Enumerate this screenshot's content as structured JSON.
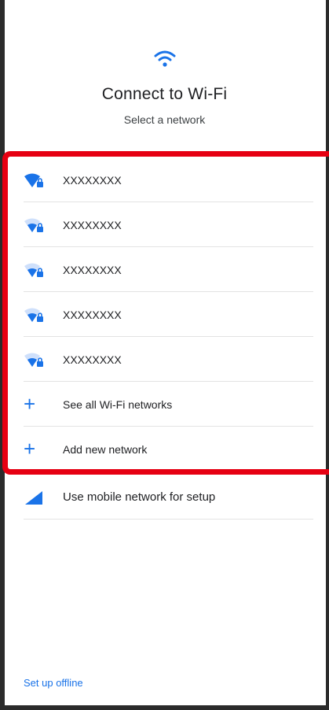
{
  "header": {
    "wifi_icon": "wifi-icon",
    "title": "Connect to Wi-Fi",
    "subtitle": "Select a network"
  },
  "networks": [
    {
      "name": "XXXXXXXX",
      "signal": "full",
      "icon": "wifi-lock-icon"
    },
    {
      "name": "XXXXXXXX",
      "signal": "partial",
      "icon": "wifi-lock-icon"
    },
    {
      "name": "XXXXXXXX",
      "signal": "partial",
      "icon": "wifi-lock-icon"
    },
    {
      "name": "XXXXXXXX",
      "signal": "partial",
      "icon": "wifi-lock-icon"
    },
    {
      "name": "XXXXXXXX",
      "signal": "partial",
      "icon": "wifi-lock-icon"
    }
  ],
  "actions": {
    "see_all": "See all Wi-Fi networks",
    "add_new": "Add new network",
    "mobile": "Use mobile network for setup"
  },
  "footer": {
    "offline": "Set up offline"
  },
  "colors": {
    "accent": "#1a73e8",
    "highlight": "#e60012",
    "text": "#202124"
  }
}
